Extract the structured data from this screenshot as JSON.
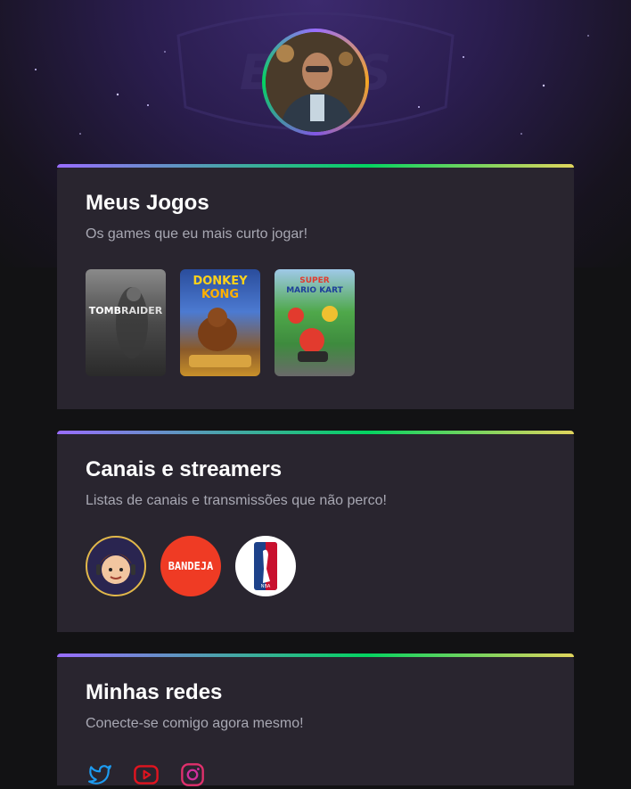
{
  "profile": {
    "avatar_alt": "Foto de perfil"
  },
  "games_section": {
    "title": "Meus Jogos",
    "subtitle": "Os games que eu mais curto jogar!",
    "games": [
      {
        "name": "Tomb Raider",
        "cover_text_a": "TOMB",
        "cover_text_b": "RAIDER"
      },
      {
        "name": "Donkey Kong",
        "cover_text_a": "DONKEY",
        "cover_text_b": "KONG"
      },
      {
        "name": "Super Mario Kart",
        "cover_text_a": "SUPER",
        "cover_text_b": "MARIO KART"
      }
    ]
  },
  "channels_section": {
    "title": "Canais e streamers",
    "subtitle": "Listas de canais e transmissões que não perco!",
    "channels": [
      {
        "name": "streamer-avatar"
      },
      {
        "name": "Bandeja",
        "label": "BANDEJA"
      },
      {
        "name": "NBA",
        "label": "NBA"
      }
    ]
  },
  "social_section": {
    "title": "Minhas redes",
    "subtitle": "Conecte-se comigo agora mesmo!",
    "links": [
      {
        "icon": "twitter-icon",
        "color": "#1d9bf0"
      },
      {
        "icon": "youtube-icon",
        "color": "#e0141f"
      },
      {
        "icon": "instagram-icon",
        "color": "#e1306c"
      }
    ]
  },
  "colors": {
    "background": "#121214",
    "card": "#29252f",
    "gradient": [
      "#996dff",
      "#04d361",
      "#e1d55d"
    ]
  }
}
